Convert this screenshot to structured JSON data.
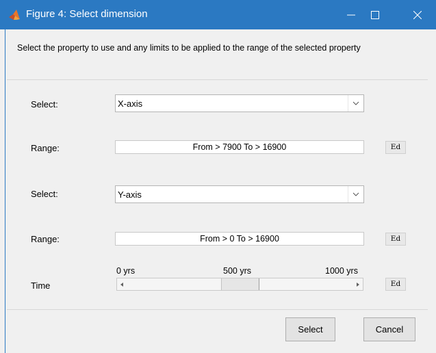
{
  "window": {
    "title": "Figure 4: Select dimension"
  },
  "instruction": "Select the property to use and any limits to be applied to the range of the selected property",
  "rows": {
    "select1": {
      "label": "Select:",
      "value": "X-axis"
    },
    "range1": {
      "label": "Range:",
      "value": "From > 7900 To > 16900",
      "ed": "Ed"
    },
    "select2": {
      "label": "Select:",
      "value": "Y-axis"
    },
    "range2": {
      "label": "Range:",
      "value": "From > 0 To > 16900",
      "ed": "Ed"
    },
    "time": {
      "label": "Time",
      "ticks": [
        "0 yrs",
        "500 yrs",
        "1000 yrs"
      ],
      "slider_position_fraction": 0.5,
      "ed": "Ed"
    }
  },
  "buttons": {
    "select": "Select",
    "cancel": "Cancel"
  },
  "colors": {
    "titlebar": "#2b79c2",
    "background": "#f0f0f0"
  },
  "icons": {
    "app": "matlab-icon",
    "minimize": "minimize-icon",
    "maximize": "maximize-icon",
    "close": "close-icon"
  }
}
